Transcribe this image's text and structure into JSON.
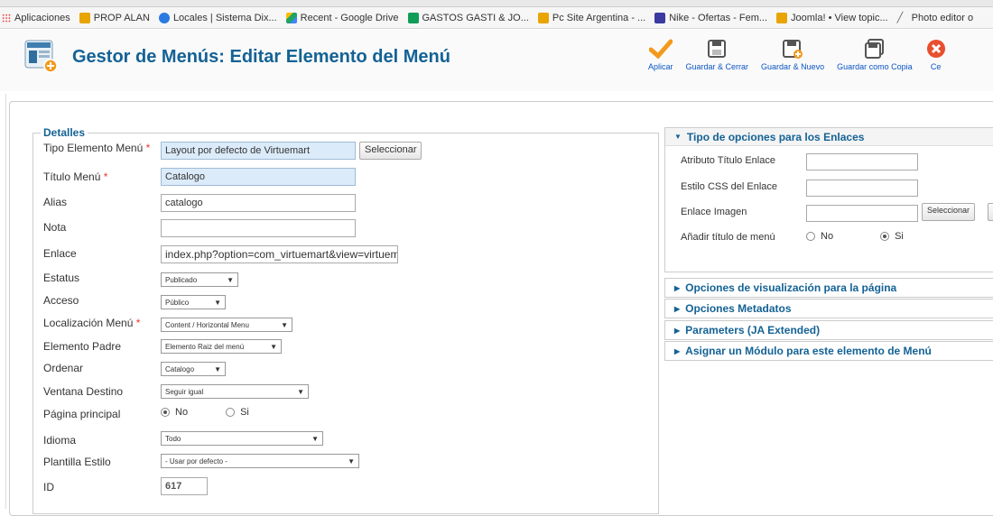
{
  "bookmarks": [
    {
      "label": "Aplicaciones",
      "icon": "apps-grid-icon",
      "color": "#e44"
    },
    {
      "label": "PROP ALAN",
      "icon": "star-icon",
      "color": "#e8a400"
    },
    {
      "label": "Locales | Sistema Dix...",
      "icon": "globe-icon",
      "color": "#2a7ae2"
    },
    {
      "label": "Recent - Google Drive",
      "icon": "drive-icon",
      "color": "#1fa463"
    },
    {
      "label": "GASTOS GASTI & JO...",
      "icon": "sheets-icon",
      "color": "#0f9d58"
    },
    {
      "label": "Pc Site Argentina - ...",
      "icon": "star-icon",
      "color": "#e8a400"
    },
    {
      "label": "Nike - Ofertas - Fem...",
      "icon": "nike-icon",
      "color": "#3a3aa0"
    },
    {
      "label": "Joomla! • View topic...",
      "icon": "star-icon",
      "color": "#e8a400"
    },
    {
      "label": "Photo editor o",
      "icon": "pen-icon",
      "color": "#666"
    }
  ],
  "header": {
    "title": "Gestor de Menús: Editar Elemento del Menú",
    "toolbar": [
      {
        "label": "Aplicar",
        "icon": "check-icon"
      },
      {
        "label": "Guardar & Cerrar",
        "icon": "save-close-icon"
      },
      {
        "label": "Guardar & Nuevo",
        "icon": "save-new-icon"
      },
      {
        "label": "Guardar como Copia",
        "icon": "save-copy-icon"
      },
      {
        "label": "Ce",
        "icon": "cancel-icon"
      }
    ]
  },
  "details": {
    "legend": "Detalles",
    "required_mark": "*",
    "fields": {
      "tipo_elemento": {
        "label": "Tipo Elemento Menú",
        "value": "Layout por defecto de Virtuemart",
        "button": "Seleccionar"
      },
      "titulo": {
        "label": "Título Menú",
        "value": "Catalogo"
      },
      "alias": {
        "label": "Alias",
        "value": "catalogo"
      },
      "nota": {
        "label": "Nota",
        "value": ""
      },
      "enlace": {
        "label": "Enlace",
        "value": "index.php?option=com_virtuemart&view=virtuemar"
      },
      "estatus": {
        "label": "Estatus",
        "value": "Publicado"
      },
      "acceso": {
        "label": "Acceso",
        "value": "Público"
      },
      "localizacion": {
        "label": "Localización Menú",
        "value": "Content / Horizontal Menu"
      },
      "padre": {
        "label": "Elemento Padre",
        "value": "Elemento Raiz del menú"
      },
      "ordenar": {
        "label": "Ordenar",
        "value": "Catalogo"
      },
      "ventana": {
        "label": "Ventana Destino",
        "value": "Seguir igual"
      },
      "principal": {
        "label": "Página principal",
        "option_no": "No",
        "option_si": "Si",
        "selected": "No"
      },
      "idioma": {
        "label": "Idioma",
        "value": "Todo"
      },
      "plantilla": {
        "label": "Plantilla Estilo",
        "value": "- Usar por defecto -"
      },
      "id": {
        "label": "ID",
        "value": "617"
      }
    }
  },
  "link_options": {
    "title": "Tipo de opciones para los Enlaces",
    "atributo_label": "Atributo Título Enlace",
    "estilo_label": "Estilo CSS del Enlace",
    "imagen_label": "Enlace Imagen",
    "imagen_button": "Seleccionar",
    "anadir_label": "Añadir título de menú",
    "anadir_no": "No",
    "anadir_si": "Si",
    "anadir_selected": "Si"
  },
  "collapsed_panels": [
    "Opciones de visualización para la página",
    "Opciones Metadatos",
    "Parameters (JA Extended)",
    "Asignar un Módulo para este elemento de Menú"
  ],
  "colors": {
    "title_blue": "#146295",
    "link_blue": "#0b55c4",
    "highlight_input": "#dcebfa",
    "required_red": "#e33"
  }
}
